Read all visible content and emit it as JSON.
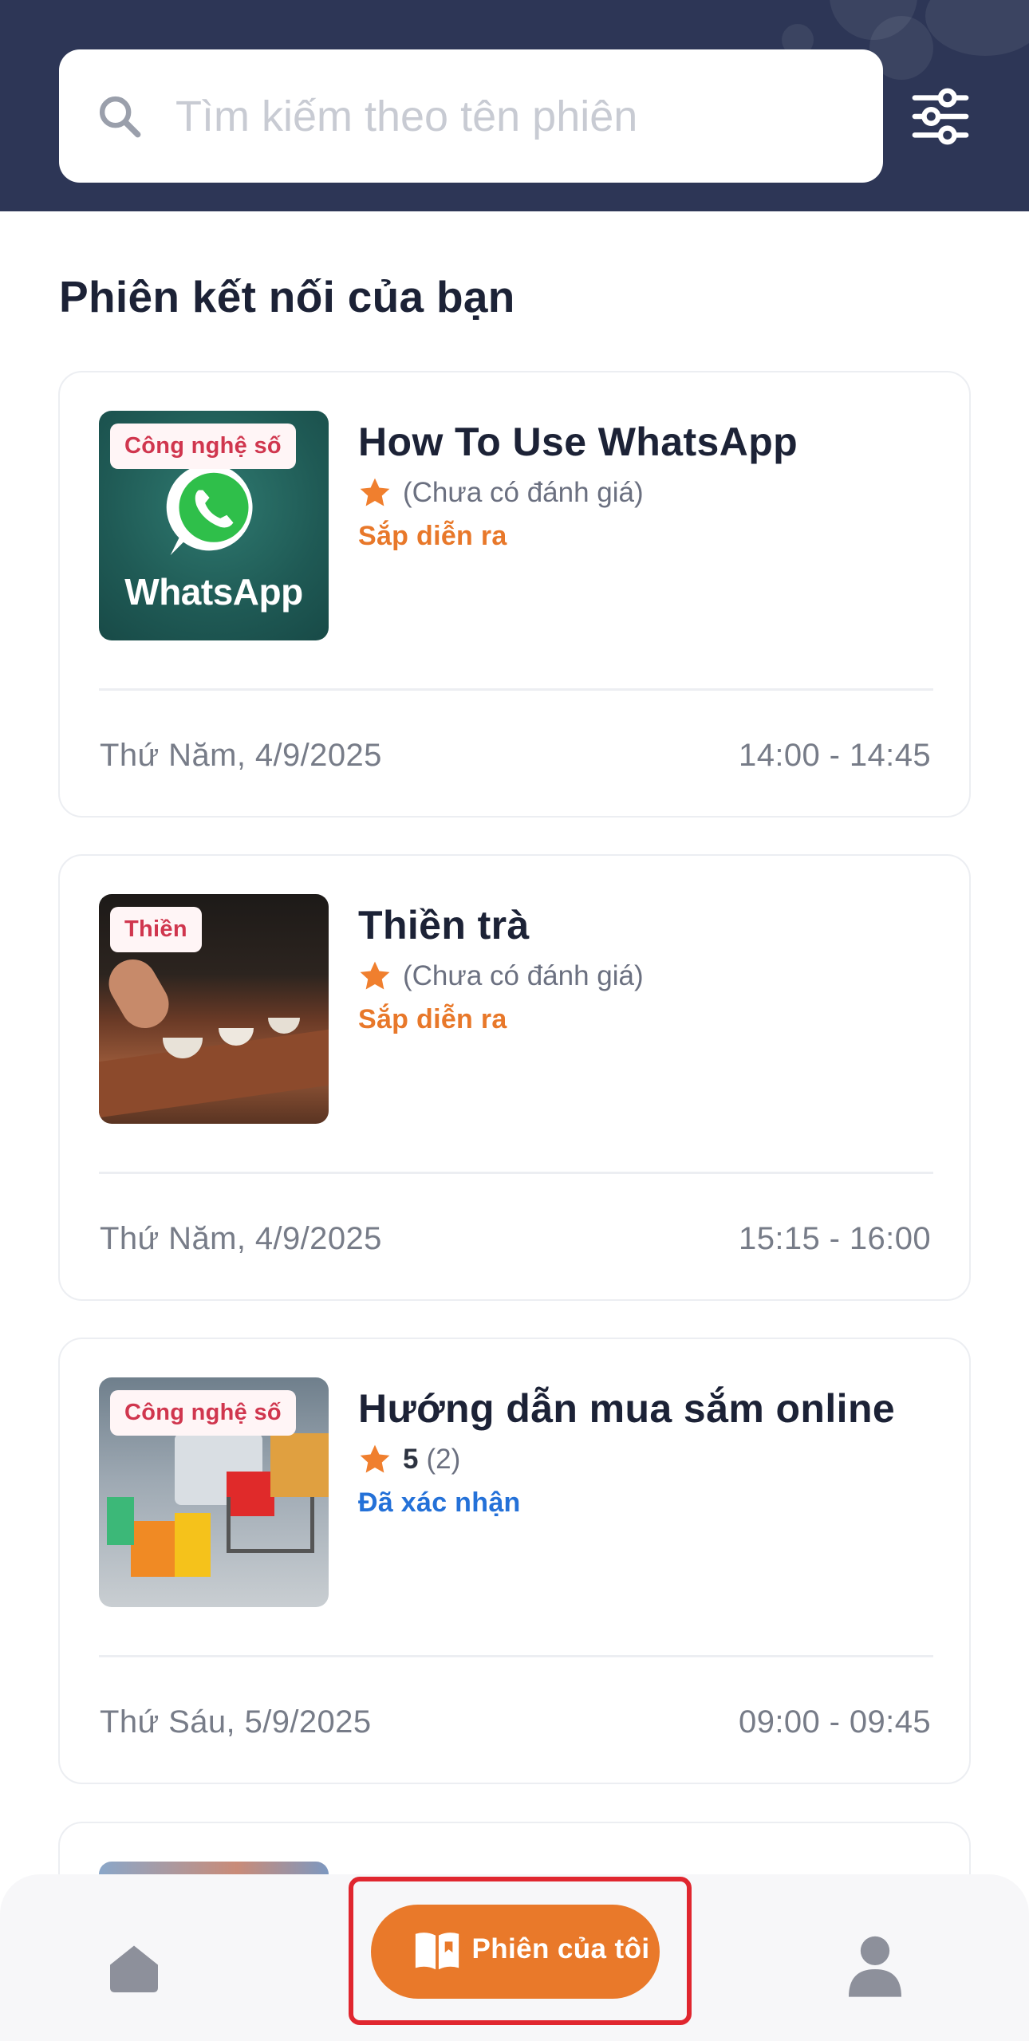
{
  "search": {
    "placeholder": "Tìm kiếm theo tên phiên"
  },
  "section_title": "Phiên kết nối của bạn",
  "sessions": [
    {
      "tag": "Công nghệ số",
      "title": "How To Use WhatsApp",
      "rating_text": "(Chưa có đánh giá)",
      "rating_score": "",
      "status": "Sắp diễn ra",
      "status_color": "#e8782a",
      "date": "Thứ Năm, 4/9/2025",
      "time": "14:00 - 14:45",
      "thumb_text": "WhatsApp"
    },
    {
      "tag": "Thiền",
      "title": "Thiền trà",
      "rating_text": "(Chưa có đánh giá)",
      "rating_score": "",
      "status": "Sắp diễn ra",
      "status_color": "#e8782a",
      "date": "Thứ Năm, 4/9/2025",
      "time": "15:15 - 16:00"
    },
    {
      "tag": "Công nghệ số",
      "title": "Hướng dẫn mua sắm online",
      "rating_score": "5",
      "rating_text": "(2)",
      "status": "Đã xác nhận",
      "status_color": "#2471d8",
      "date": "Thứ Sáu, 5/9/2025",
      "time": "09:00 - 09:45"
    }
  ],
  "nav": {
    "home_icon": "home-icon",
    "sessions_label": "Phiên của tôi",
    "profile_icon": "user-icon"
  },
  "colors": {
    "header": "#2d3656",
    "accent": "#e9792a",
    "star": "#f07f2e",
    "tag_text": "#d0364e",
    "highlight": "#e0262f"
  }
}
